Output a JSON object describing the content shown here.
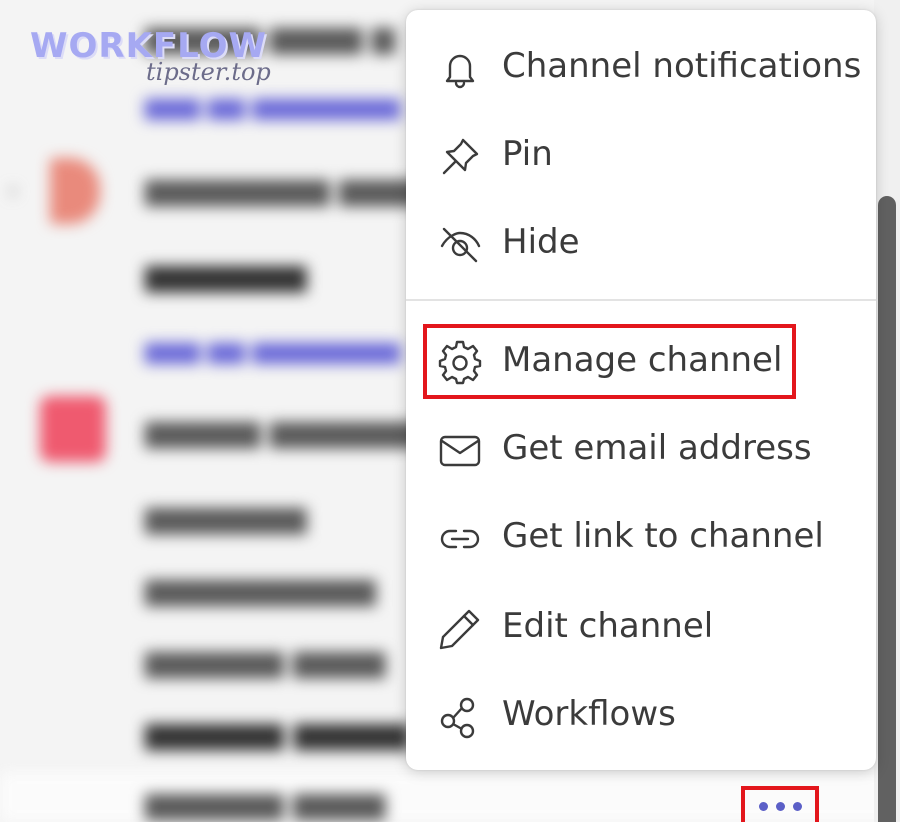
{
  "watermark": {
    "title": "WORKFLOW",
    "subtitle": "tipster.top"
  },
  "menu": {
    "items": [
      {
        "label": "Channel notifications",
        "icon": "bell-icon"
      },
      {
        "label": "Pin",
        "icon": "pin-icon"
      },
      {
        "label": "Hide",
        "icon": "eye-off-icon"
      },
      {
        "label": "Manage channel",
        "icon": "gear-icon"
      },
      {
        "label": "Get email address",
        "icon": "mail-icon"
      },
      {
        "label": "Get link to channel",
        "icon": "link-icon"
      },
      {
        "label": "Edit channel",
        "icon": "pencil-icon"
      },
      {
        "label": "Workflows",
        "icon": "workflows-icon"
      }
    ]
  },
  "colors": {
    "highlight": "#e3161c",
    "accent": "#5b5fc7",
    "menu_text": "#3b3b3b"
  }
}
